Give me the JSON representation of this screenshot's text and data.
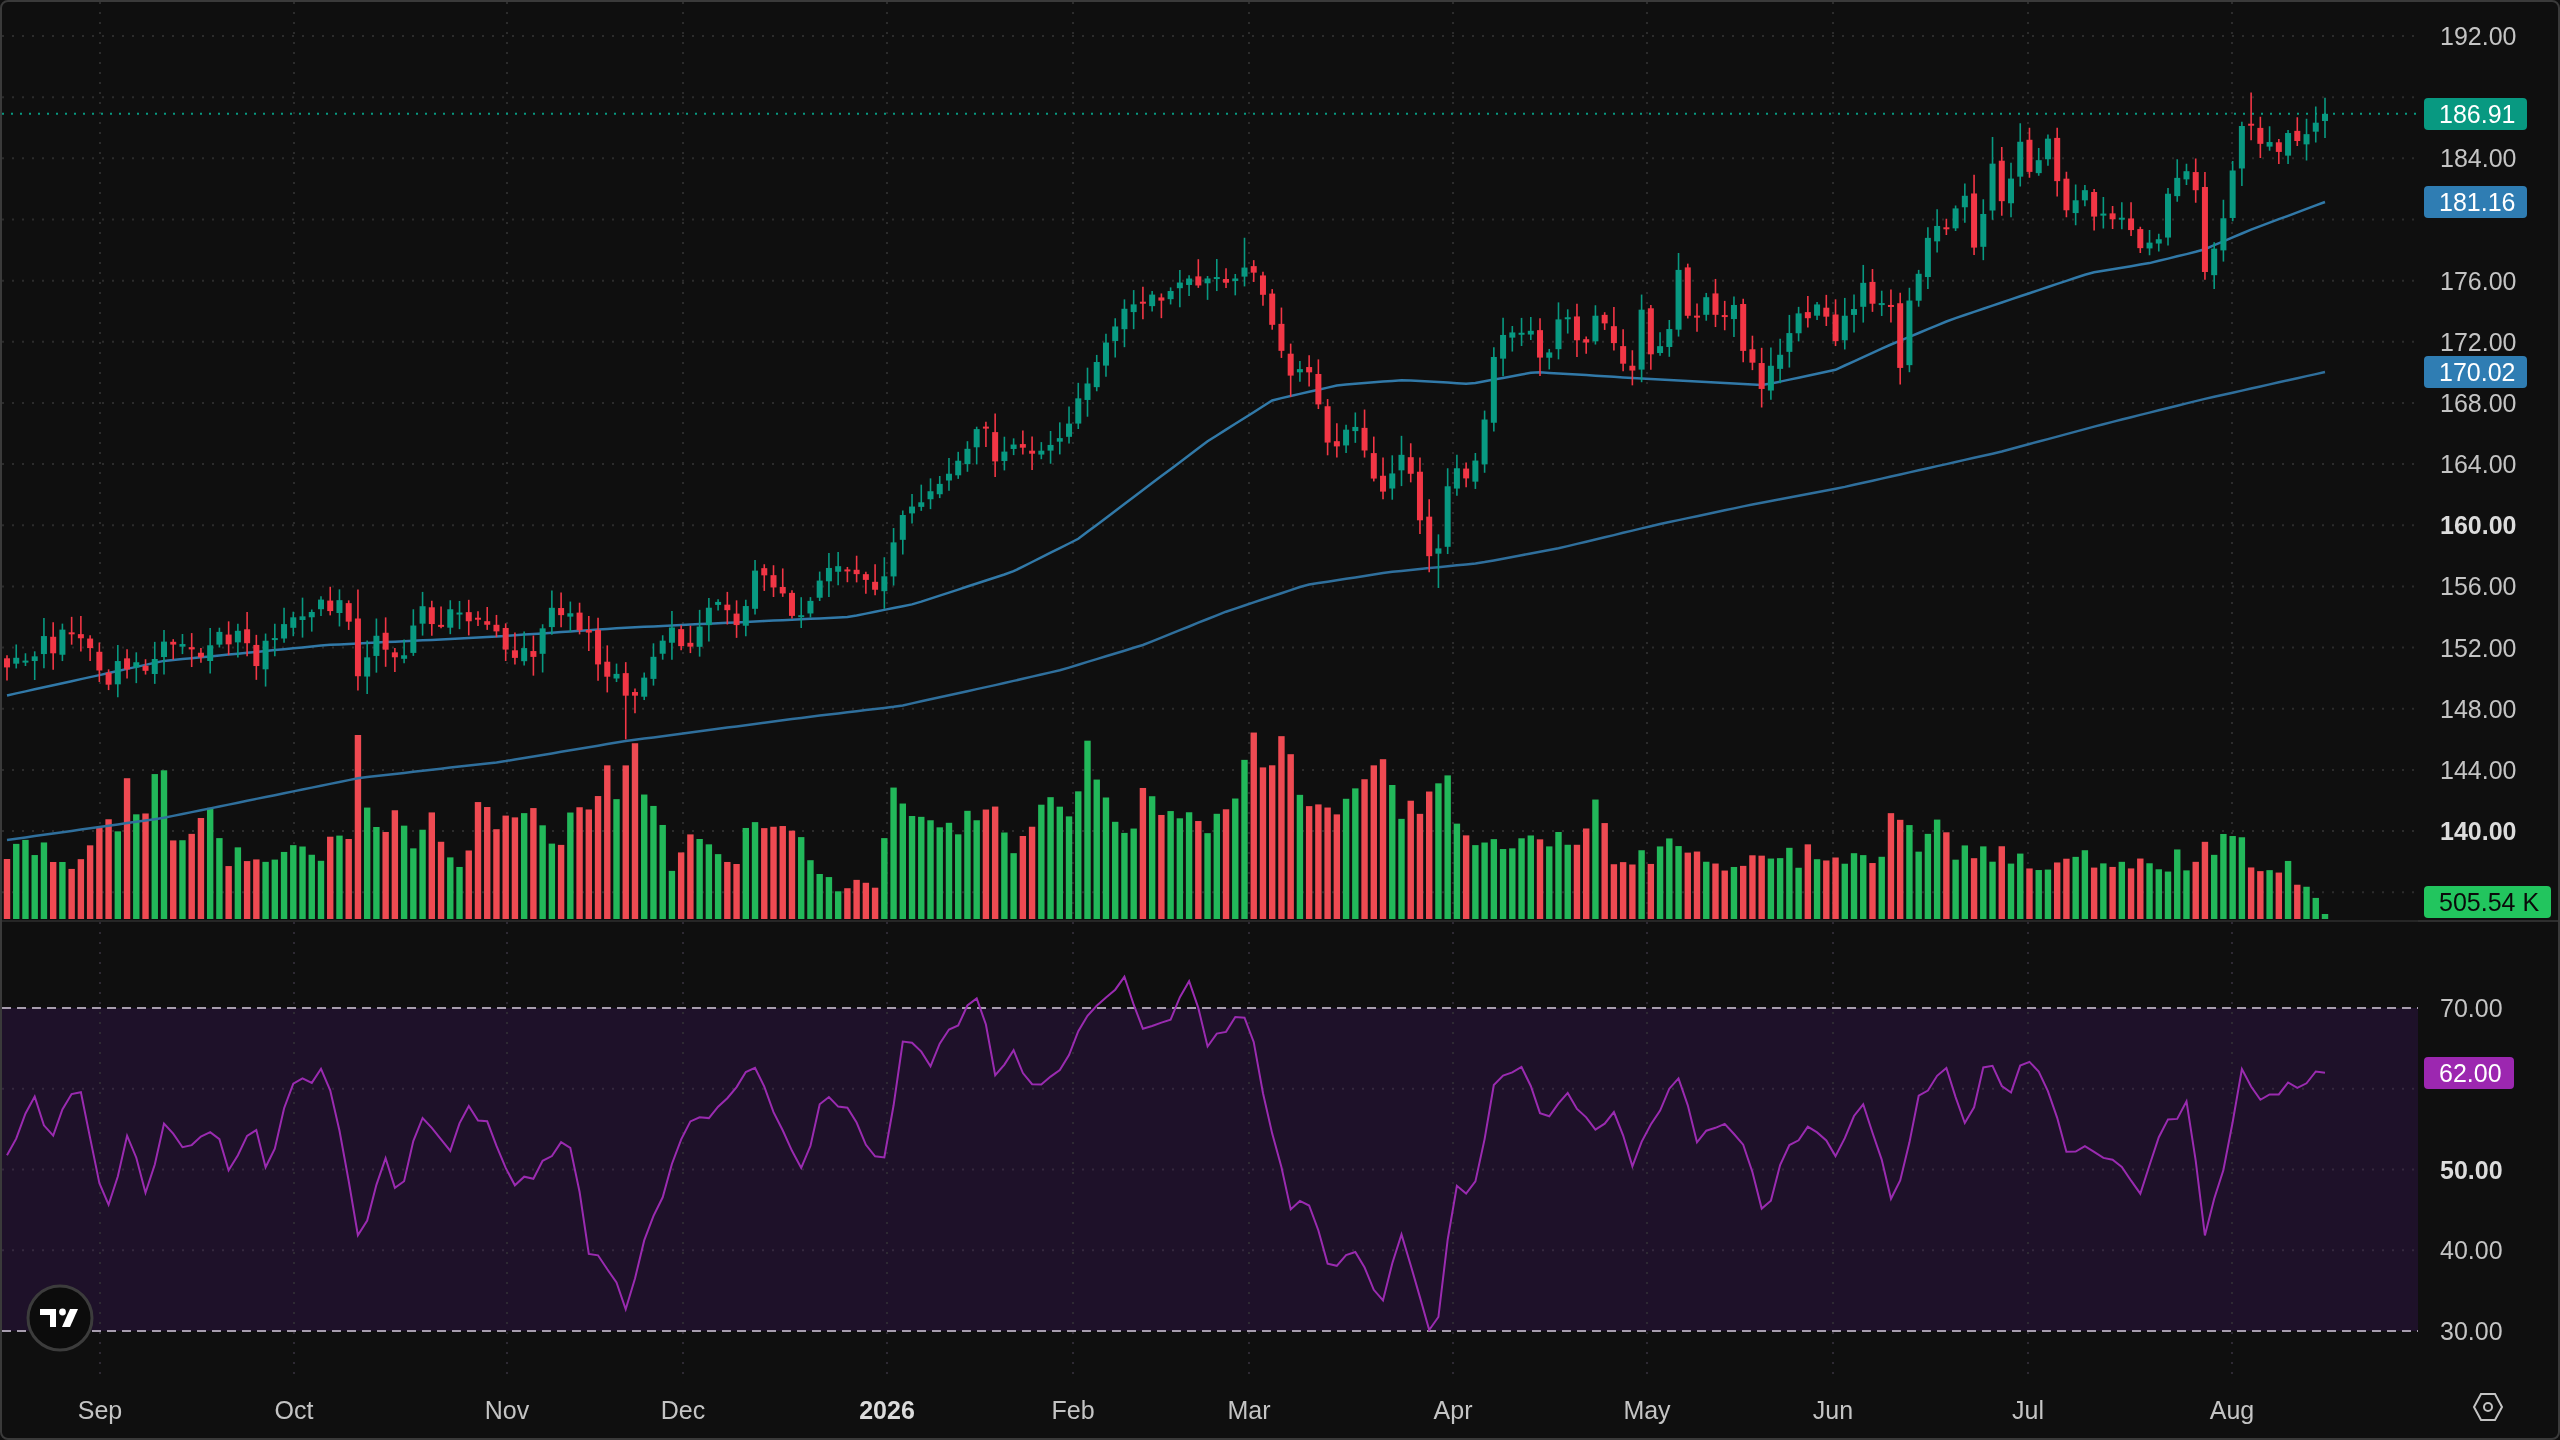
{
  "price_pane": {
    "axis_ticks": [
      {
        "label": "192.00",
        "major": false
      },
      {
        "label": "184.00",
        "major": false
      },
      {
        "label": "176.00",
        "major": false
      },
      {
        "label": "172.00",
        "major": false
      },
      {
        "label": "168.00",
        "major": false
      },
      {
        "label": "164.00",
        "major": false
      },
      {
        "label": "160.00",
        "major": true
      },
      {
        "label": "156.00",
        "major": false
      },
      {
        "label": "152.00",
        "major": false
      },
      {
        "label": "148.00",
        "major": false
      },
      {
        "label": "144.00",
        "major": false
      },
      {
        "label": "140.00",
        "major": true
      }
    ],
    "badges": [
      {
        "label": "186.91",
        "color": "#089981"
      },
      {
        "label": "181.16",
        "color": "#2f7db3"
      },
      {
        "label": "170.02",
        "color": "#2f7db3"
      }
    ],
    "volume_badge": {
      "label": "505.54 K",
      "color": "#22c55e"
    }
  },
  "rsi_pane": {
    "axis_ticks": [
      {
        "label": "70.00",
        "major": false
      },
      {
        "label": "50.00",
        "major": true
      },
      {
        "label": "40.00",
        "major": false
      },
      {
        "label": "30.00",
        "major": false
      }
    ],
    "badge": {
      "label": "62.00",
      "color": "#9c27b0"
    }
  },
  "time_axis": {
    "labels": [
      {
        "label": "Sep",
        "major": false
      },
      {
        "label": "Oct",
        "major": false
      },
      {
        "label": "Nov",
        "major": false
      },
      {
        "label": "Dec",
        "major": false
      },
      {
        "label": "2026",
        "major": true
      },
      {
        "label": "Feb",
        "major": false
      },
      {
        "label": "Mar",
        "major": false
      },
      {
        "label": "Apr",
        "major": false
      },
      {
        "label": "May",
        "major": false
      },
      {
        "label": "Jun",
        "major": false
      },
      {
        "label": "Jul",
        "major": false
      },
      {
        "label": "Aug",
        "major": false
      }
    ]
  }
}
